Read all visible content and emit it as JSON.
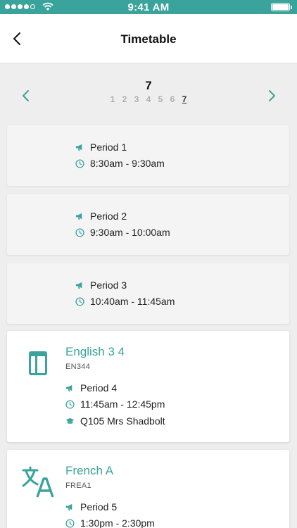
{
  "status_bar": {
    "time": "9:41 AM",
    "signal_icon": "signal-dots-icon",
    "wifi_icon": "wifi-icon",
    "battery_icon": "battery-icon"
  },
  "nav": {
    "title": "Timetable",
    "back_icon": "chevron-left-icon"
  },
  "day_selector": {
    "current_day": "7",
    "days": [
      "1",
      "2",
      "3",
      "4",
      "5",
      "6",
      "7"
    ],
    "selected_day": "7",
    "prev_icon": "chevron-left-icon",
    "next_icon": "chevron-right-icon"
  },
  "accent_color": "#3aa39b",
  "periods": [
    {
      "period": "Period 1",
      "time": "8:30am - 9:30am"
    },
    {
      "period": "Period 2",
      "time": "9:30am - 10:00am"
    },
    {
      "period": "Period 3",
      "time": "10:40am - 11:45am"
    },
    {
      "subject": "English 3 4",
      "code": "EN344",
      "period": "Period 4",
      "time": "11:45am - 12:45pm",
      "room_teacher": "Q105 Mrs Shadbolt",
      "icon": "book-icon"
    },
    {
      "subject": "French A",
      "code": "FREA1",
      "period": "Period 5",
      "time": "1:30pm - 2:30pm",
      "icon": "translate-icon"
    }
  ]
}
